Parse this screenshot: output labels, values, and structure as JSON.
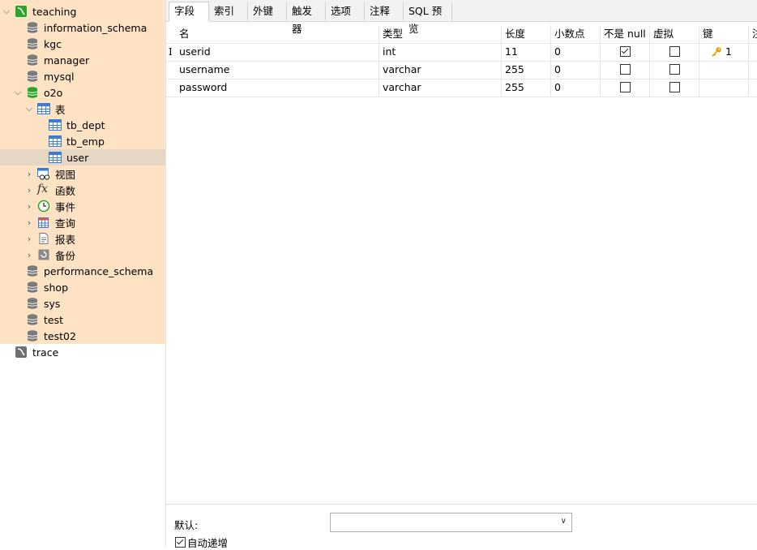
{
  "sidebar": {
    "items": [
      {
        "label": "teaching",
        "type": "connection",
        "expanded": true,
        "icon": "mysql-connection-icon"
      },
      {
        "label": "information_schema",
        "type": "database",
        "icon": "database-icon"
      },
      {
        "label": "kgc",
        "type": "database",
        "icon": "database-icon"
      },
      {
        "label": "manager",
        "type": "database",
        "icon": "database-icon"
      },
      {
        "label": "mysql",
        "type": "database",
        "icon": "database-icon"
      },
      {
        "label": "o2o",
        "type": "database-open",
        "expanded": true,
        "icon": "database-icon"
      },
      {
        "label": "表",
        "type": "folder-tables",
        "expanded": true,
        "icon": "table-icon"
      },
      {
        "label": "tb_dept",
        "type": "table",
        "icon": "table-icon"
      },
      {
        "label": "tb_emp",
        "type": "table",
        "icon": "table-icon"
      },
      {
        "label": "user",
        "type": "table",
        "selected": true,
        "icon": "table-icon"
      },
      {
        "label": "视图",
        "type": "folder-views",
        "icon": "view-icon"
      },
      {
        "label": "函数",
        "type": "folder-functions",
        "icon": "function-icon"
      },
      {
        "label": "事件",
        "type": "folder-events",
        "icon": "clock-icon"
      },
      {
        "label": "查询",
        "type": "folder-queries",
        "icon": "query-icon"
      },
      {
        "label": "报表",
        "type": "folder-reports",
        "icon": "report-icon"
      },
      {
        "label": "备份",
        "type": "folder-backups",
        "icon": "backup-icon"
      },
      {
        "label": "performance_schema",
        "type": "database",
        "icon": "database-icon"
      },
      {
        "label": "shop",
        "type": "database",
        "icon": "database-icon"
      },
      {
        "label": "sys",
        "type": "database",
        "icon": "database-icon"
      },
      {
        "label": "test",
        "type": "database",
        "icon": "database-icon"
      },
      {
        "label": "test02",
        "type": "database",
        "icon": "database-icon"
      },
      {
        "label": "trace",
        "type": "connection",
        "icon": "mysql-connection-icon"
      }
    ]
  },
  "tabs": [
    {
      "label": "字段",
      "active": true
    },
    {
      "label": "索引"
    },
    {
      "label": "外键"
    },
    {
      "label": "触发器"
    },
    {
      "label": "选项"
    },
    {
      "label": "注释"
    },
    {
      "label": "SQL 预览"
    }
  ],
  "grid": {
    "columns": [
      "名",
      "类型",
      "长度",
      "小数点",
      "不是 null",
      "虚拟",
      "键",
      "注"
    ],
    "rows": [
      {
        "name": "userid",
        "type": "int",
        "length": "11",
        "decimals": "0",
        "not_null": true,
        "virtual": false,
        "key": "1"
      },
      {
        "name": "username",
        "type": "varchar",
        "length": "255",
        "decimals": "0",
        "not_null": false,
        "virtual": false,
        "key": ""
      },
      {
        "name": "password",
        "type": "varchar",
        "length": "255",
        "decimals": "0",
        "not_null": false,
        "virtual": false,
        "key": ""
      }
    ]
  },
  "props": {
    "default_label": "默认:",
    "default_value": "",
    "auto_increment_label": "自动递增",
    "auto_increment": true
  },
  "colors": {
    "tree_highlight": "#fde2c4",
    "selected_row": "#e6d6c4",
    "key_color": "#e0a400",
    "db_active": "#2ba52b"
  }
}
